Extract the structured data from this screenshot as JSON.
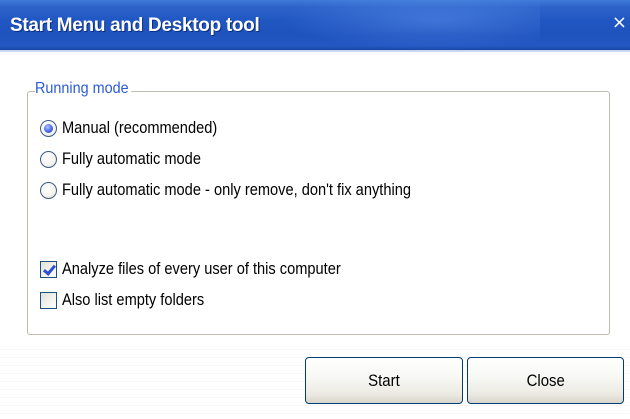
{
  "window": {
    "title": "Start Menu and Desktop tool",
    "close_glyph": "×"
  },
  "running_mode": {
    "legend": "Running mode",
    "options": [
      {
        "label": "Manual (recommended)",
        "selected": true
      },
      {
        "label": "Fully automatic mode",
        "selected": false
      },
      {
        "label": "Fully automatic mode - only remove, don't fix anything",
        "selected": false
      }
    ],
    "checkboxes": [
      {
        "label": "Analyze files of every user of this computer",
        "checked": true
      },
      {
        "label": "Also list empty folders",
        "checked": false
      }
    ]
  },
  "buttons": {
    "start_label": "Start",
    "close_label": "Close"
  },
  "colors": {
    "title_bar": "#2157c2",
    "legend_text": "#2a5bd7",
    "button_border": "#003c74"
  }
}
